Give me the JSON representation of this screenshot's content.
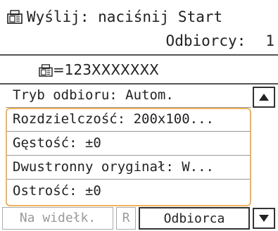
{
  "header": {
    "status_text": "Wyślij: naciśnij Start",
    "recipients_label": "Odbiorcy:",
    "recipients_count": "1",
    "destination": "=123XXXXXXX"
  },
  "settings_list": [
    {
      "label": "Tryb odbioru: Autom."
    },
    {
      "label": "Rozdzielczość: 200x100..."
    },
    {
      "label": "Gęstość: ±0"
    },
    {
      "label": "Dwustronny oryginał: W..."
    },
    {
      "label": "Ostrość: ±0"
    }
  ],
  "bottom_bar": {
    "on_hook_label": "Na widełk.",
    "r_label": "R",
    "recipient_label": "Odbiorca"
  },
  "colors": {
    "selection_frame": "#f0b45a"
  },
  "icons": {
    "fax": "fax-icon",
    "scroll_up": "arrow-up-icon",
    "scroll_down": "arrow-down-icon"
  }
}
